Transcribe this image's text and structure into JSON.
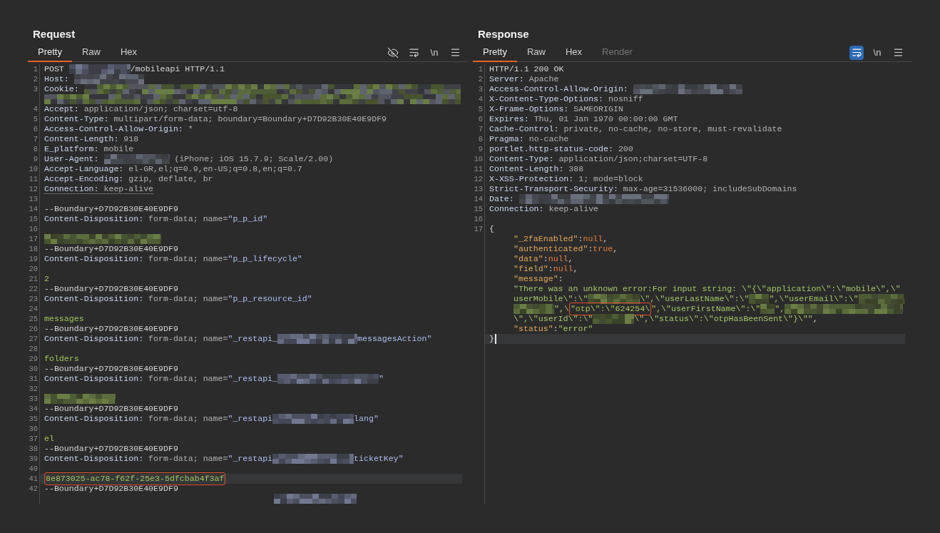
{
  "request": {
    "title": "Request",
    "focused": false,
    "tabs": [
      {
        "label": "Pretty",
        "selected": true,
        "disabled": false
      },
      {
        "label": "Raw",
        "selected": false,
        "disabled": false
      },
      {
        "label": "Hex",
        "selected": false,
        "disabled": false
      }
    ],
    "toolbar": [
      {
        "kind": "hide",
        "on": false
      },
      {
        "kind": "wrap",
        "on": false
      },
      {
        "kind": "newline",
        "label": "\\n",
        "on": false
      },
      {
        "kind": "menu",
        "on": false
      }
    ],
    "lines": [
      {
        "number": "1",
        "current": false,
        "segments": [
          {
            "kind": "plain",
            "text": "POST "
          },
          {
            "kind": "redacted"
          },
          {
            "kind": "plain",
            "text": "/mobileapi HTTP/1.1"
          }
        ]
      },
      {
        "number": "2",
        "current": false,
        "segments": [
          {
            "kind": "key",
            "text": "Host: "
          },
          {
            "kind": "redacted"
          }
        ]
      },
      {
        "number": "3",
        "current": false,
        "segments": [
          {
            "kind": "key",
            "text": "Cookie: "
          },
          {
            "kind": "redacted"
          }
        ]
      },
      {
        "current": false,
        "segments": [
          {
            "kind": "redacted"
          }
        ]
      },
      {
        "number": "4",
        "current": false,
        "segments": [
          {
            "kind": "key",
            "text": "Accept: "
          },
          {
            "kind": "value",
            "text": "application/json; charset=utf-8"
          }
        ]
      },
      {
        "number": "5",
        "current": false,
        "segments": [
          {
            "kind": "key",
            "text": "Content-Type: "
          },
          {
            "kind": "value",
            "text": "multipart/form-data; boundary=Boundary+D7D92B30E40E9DF9"
          }
        ]
      },
      {
        "number": "6",
        "current": false,
        "segments": [
          {
            "kind": "key",
            "text": "Access-Control-Allow-Origin: "
          },
          {
            "kind": "value",
            "text": "*"
          }
        ]
      },
      {
        "number": "7",
        "current": false,
        "segments": [
          {
            "kind": "key",
            "text": "Content-Length: "
          },
          {
            "kind": "value",
            "text": "918"
          }
        ]
      },
      {
        "number": "8",
        "current": false,
        "segments": [
          {
            "kind": "key",
            "text": "E_platform: "
          },
          {
            "kind": "value",
            "text": "mobile"
          }
        ]
      },
      {
        "number": "9",
        "current": false,
        "segments": [
          {
            "kind": "key",
            "text": "User-Agent: "
          },
          {
            "kind": "redacted"
          },
          {
            "kind": "value",
            "text": " (iPhone; iOS 15.7.9; Scale/2.00)"
          }
        ]
      },
      {
        "number": "10",
        "current": false,
        "segments": [
          {
            "kind": "key",
            "text": "Accept-Language: "
          },
          {
            "kind": "value",
            "text": "el-GR,el;q=0.9,en-US;q=0.8,en;q=0.7"
          }
        ]
      },
      {
        "number": "11",
        "current": false,
        "segments": [
          {
            "kind": "key",
            "text": "Accept-Encoding: "
          },
          {
            "kind": "value",
            "text": "gzip, deflate, br"
          }
        ]
      },
      {
        "number": "12",
        "current": false,
        "underlined": true,
        "segments": [
          {
            "kind": "key",
            "text": "Connection: "
          },
          {
            "kind": "value",
            "text": "keep-alive"
          }
        ]
      },
      {
        "number": "13",
        "current": false
      },
      {
        "number": "14",
        "current": false,
        "segments": [
          {
            "kind": "plain",
            "text": "--Boundary+D7D92B30E40E9DF9"
          }
        ]
      },
      {
        "number": "15",
        "current": false,
        "segments": [
          {
            "kind": "key",
            "text": "Content-Disposition: "
          },
          {
            "kind": "value",
            "text": "form-data; name="
          },
          {
            "kind": "name",
            "text": "\"p_p_id\""
          }
        ]
      },
      {
        "number": "16",
        "current": false
      },
      {
        "number": "17",
        "current": false,
        "segments": [
          {
            "kind": "redacted"
          }
        ]
      },
      {
        "number": "18",
        "current": false,
        "segments": [
          {
            "kind": "plain",
            "text": "--Boundary+D7D92B30E40E9DF9"
          }
        ]
      },
      {
        "number": "19",
        "current": false,
        "segments": [
          {
            "kind": "key",
            "text": "Content-Disposition: "
          },
          {
            "kind": "value",
            "text": "form-data; name="
          },
          {
            "kind": "name",
            "text": "\"p_p_lifecycle\""
          }
        ]
      },
      {
        "number": "20",
        "current": false
      },
      {
        "number": "21",
        "current": false,
        "segments": [
          {
            "kind": "data",
            "text": "2"
          }
        ]
      },
      {
        "number": "22",
        "current": false,
        "segments": [
          {
            "kind": "plain",
            "text": "--Boundary+D7D92B30E40E9DF9"
          }
        ]
      },
      {
        "number": "23",
        "current": false,
        "segments": [
          {
            "kind": "key",
            "text": "Content-Disposition: "
          },
          {
            "kind": "value",
            "text": "form-data; name="
          },
          {
            "kind": "name",
            "text": "\"p_p_resource_id\""
          }
        ]
      },
      {
        "number": "24",
        "current": false
      },
      {
        "number": "25",
        "current": false,
        "segments": [
          {
            "kind": "data",
            "text": "messages"
          }
        ]
      },
      {
        "number": "26",
        "current": false,
        "segments": [
          {
            "kind": "plain",
            "text": "--Boundary+D7D92B30E40E9DF9"
          }
        ]
      },
      {
        "number": "27",
        "current": false,
        "segments": [
          {
            "kind": "key",
            "text": "Content-Disposition: "
          },
          {
            "kind": "value",
            "text": "form-data; name="
          },
          {
            "kind": "name",
            "text": "\"_restapi_"
          },
          {
            "kind": "redacted"
          },
          {
            "kind": "name",
            "text": "messagesAction\""
          }
        ]
      },
      {
        "number": "28",
        "current": false
      },
      {
        "number": "29",
        "current": false,
        "segments": [
          {
            "kind": "data",
            "text": "folders"
          }
        ]
      },
      {
        "number": "30",
        "current": false,
        "segments": [
          {
            "kind": "plain",
            "text": "--Boundary+D7D92B30E40E9DF9"
          }
        ]
      },
      {
        "number": "31",
        "current": false,
        "segments": [
          {
            "kind": "key",
            "text": "Content-Disposition: "
          },
          {
            "kind": "value",
            "text": "form-data; name="
          },
          {
            "kind": "name",
            "text": "\"_restapi_"
          },
          {
            "kind": "redacted"
          },
          {
            "kind": "name",
            "text": "\""
          }
        ]
      },
      {
        "number": "32",
        "current": false
      },
      {
        "number": "33",
        "current": false,
        "segments": [
          {
            "kind": "redacted"
          }
        ]
      },
      {
        "number": "34",
        "current": false,
        "segments": [
          {
            "kind": "plain",
            "text": "--Boundary+D7D92B30E40E9DF9"
          }
        ]
      },
      {
        "number": "35",
        "current": false,
        "segments": [
          {
            "kind": "key",
            "text": "Content-Disposition: "
          },
          {
            "kind": "value",
            "text": "form-data; name="
          },
          {
            "kind": "name",
            "text": "\"_restapi"
          },
          {
            "kind": "redacted"
          },
          {
            "kind": "name",
            "text": "lang\""
          }
        ]
      },
      {
        "number": "36",
        "current": false
      },
      {
        "number": "37",
        "current": false,
        "segments": [
          {
            "kind": "data",
            "text": "el"
          }
        ]
      },
      {
        "number": "38",
        "current": false,
        "segments": [
          {
            "kind": "plain",
            "text": "--Boundary+D7D92B30E40E9DF9"
          }
        ]
      },
      {
        "number": "39",
        "current": false,
        "segments": [
          {
            "kind": "key",
            "text": "Content-Disposition: "
          },
          {
            "kind": "value",
            "text": "form-data; name="
          },
          {
            "kind": "name",
            "text": "\"_restapi"
          },
          {
            "kind": "redacted"
          },
          {
            "kind": "name",
            "text": "ticketKey\""
          }
        ]
      },
      {
        "number": "40",
        "current": false
      },
      {
        "number": "41",
        "current": true,
        "segments": [
          {
            "kind": "boxed",
            "text": "8e873025-ac78-f62f-25e3-5dfcbab4f3af"
          }
        ]
      },
      {
        "number": "42",
        "current": false,
        "segments": [
          {
            "kind": "plain",
            "text": "--Boundary+D7D92B30E40E9DF9"
          }
        ]
      }
    ]
  },
  "response": {
    "title": "Response",
    "focused": true,
    "tabs": [
      {
        "label": "Pretty",
        "selected": true,
        "disabled": false
      },
      {
        "label": "Raw",
        "selected": false,
        "disabled": false
      },
      {
        "label": "Hex",
        "selected": false,
        "disabled": false
      },
      {
        "label": "Render",
        "selected": false,
        "disabled": true
      }
    ],
    "toolbar": [
      {
        "kind": "wrap",
        "on": true
      },
      {
        "kind": "newline",
        "label": "\\n",
        "on": false
      },
      {
        "kind": "menu",
        "on": false
      }
    ],
    "lines": [
      {
        "number": "1",
        "current": false,
        "segments": [
          {
            "kind": "plain",
            "text": "HTTP/1.1 200 OK"
          }
        ]
      },
      {
        "number": "2",
        "current": false,
        "segments": [
          {
            "kind": "key",
            "text": "Server: "
          },
          {
            "kind": "value",
            "text": "Apache"
          }
        ]
      },
      {
        "number": "3",
        "current": false,
        "segments": [
          {
            "kind": "key",
            "text": "Access-Control-Allow-Origin: "
          },
          {
            "kind": "redacted"
          }
        ]
      },
      {
        "number": "4",
        "current": false,
        "segments": [
          {
            "kind": "key",
            "text": "X-Content-Type-Options: "
          },
          {
            "kind": "value",
            "text": "nosniff"
          }
        ]
      },
      {
        "number": "5",
        "current": false,
        "segments": [
          {
            "kind": "key",
            "text": "X-Frame-Options: "
          },
          {
            "kind": "value",
            "text": "SAMEORIGIN"
          }
        ]
      },
      {
        "number": "6",
        "current": false,
        "segments": [
          {
            "kind": "key",
            "text": "Expires: "
          },
          {
            "kind": "value",
            "text": "Thu, 01 Jan 1970 00:00:00 GMT"
          }
        ]
      },
      {
        "number": "7",
        "current": false,
        "segments": [
          {
            "kind": "key",
            "text": "Cache-Control: "
          },
          {
            "kind": "value",
            "text": "private, no-cache, no-store, must-revalidate"
          }
        ]
      },
      {
        "number": "8",
        "current": false,
        "segments": [
          {
            "kind": "key",
            "text": "Pragma: "
          },
          {
            "kind": "value",
            "text": "no-cache"
          }
        ]
      },
      {
        "number": "9",
        "current": false,
        "segments": [
          {
            "kind": "key",
            "text": "portlet.http-status-code: "
          },
          {
            "kind": "value",
            "text": "200"
          }
        ]
      },
      {
        "number": "10",
        "current": false,
        "segments": [
          {
            "kind": "key",
            "text": "Content-Type: "
          },
          {
            "kind": "value",
            "text": "application/json;charset=UTF-8"
          }
        ]
      },
      {
        "number": "11",
        "current": false,
        "segments": [
          {
            "kind": "key",
            "text": "Content-Length: "
          },
          {
            "kind": "value",
            "text": "388"
          }
        ]
      },
      {
        "number": "12",
        "current": false,
        "segments": [
          {
            "kind": "key",
            "text": "X-XSS-Protection: "
          },
          {
            "kind": "value",
            "text": "1; mode=block"
          }
        ]
      },
      {
        "number": "13",
        "current": false,
        "segments": [
          {
            "kind": "key",
            "text": "Strict-Transport-Security: "
          },
          {
            "kind": "value",
            "text": "max-age=31536000; includeSubDomains"
          }
        ]
      },
      {
        "number": "14",
        "current": false,
        "segments": [
          {
            "kind": "key",
            "text": "Date: "
          },
          {
            "kind": "redacted"
          }
        ]
      },
      {
        "number": "15",
        "current": false,
        "segments": [
          {
            "kind": "key",
            "text": "Connection: "
          },
          {
            "kind": "value",
            "text": "keep-alive"
          }
        ]
      },
      {
        "number": "16",
        "current": false
      },
      {
        "number": "17",
        "current": false,
        "segments": [
          {
            "kind": "plain",
            "text": "{"
          }
        ],
        "children": [
          {
            "segments": [
              {
                "kind": "jkey",
                "text": "\"_2faEnabled\""
              },
              {
                "kind": "punct",
                "text": ":"
              },
              {
                "kind": "literal",
                "text": "null"
              },
              {
                "kind": "punct",
                "text": ","
              }
            ]
          },
          {
            "segments": [
              {
                "kind": "jkey",
                "text": "\"authenticated\""
              },
              {
                "kind": "punct",
                "text": ":"
              },
              {
                "kind": "literal",
                "text": "true"
              },
              {
                "kind": "punct",
                "text": ","
              }
            ]
          },
          {
            "segments": [
              {
                "kind": "jkey",
                "text": "\"data\""
              },
              {
                "kind": "punct",
                "text": ":"
              },
              {
                "kind": "literal",
                "text": "null"
              },
              {
                "kind": "punct",
                "text": ","
              }
            ]
          },
          {
            "segments": [
              {
                "kind": "jkey",
                "text": "\"field\""
              },
              {
                "kind": "punct",
                "text": ":"
              },
              {
                "kind": "literal",
                "text": "null"
              },
              {
                "kind": "punct",
                "text": ","
              }
            ]
          },
          {
            "segments": [
              {
                "kind": "jkey",
                "text": "\"message\""
              },
              {
                "kind": "punct",
                "text": ":"
              }
            ]
          },
          {
            "segments": [
              {
                "kind": "string",
                "text": "\"There was an unknown error:For input string: \\\"{\\\"application\\\":\\\"mobile\\\",\\\""
              }
            ]
          },
          {
            "segments": [
              {
                "kind": "string",
                "text": "userMobile\\\":\\\""
              },
              {
                "kind": "redacted"
              },
              {
                "kind": "string",
                "text": "\\\",\\\"userLastName\\\":\\\""
              },
              {
                "kind": "redacted"
              },
              {
                "kind": "string",
                "text": "\",\\\"userEmail\\\":\\\""
              },
              {
                "kind": "redacted"
              }
            ]
          },
          {
            "segments": [
              {
                "kind": "redacted"
              },
              {
                "kind": "string",
                "text": "\",\\"
              },
              {
                "kind": "boxed",
                "text": "\"otp\\\":\\\"624254\\"
              },
              {
                "kind": "string",
                "text": "\",\\\"userFirstName\\\":\\\""
              },
              {
                "kind": "redacted"
              },
              {
                "kind": "string",
                "text": "\","
              },
              {
                "kind": "redacted"
              }
            ]
          },
          {
            "segments": [
              {
                "kind": "string",
                "text": "\\\",\\\"userId\\\":\\\""
              },
              {
                "kind": "redacted"
              },
              {
                "kind": "string",
                "text": "\\\",\\\"status\\\":\\\"otpHasBeenSent\\\"}\\\"\""
              },
              {
                "kind": "punct",
                "text": ","
              }
            ]
          },
          {
            "segments": [
              {
                "kind": "jkey",
                "text": "\"status\""
              },
              {
                "kind": "punct",
                "text": ":"
              },
              {
                "kind": "string",
                "text": "\"error\""
              }
            ]
          }
        ]
      },
      {
        "current": true,
        "segments": [
          {
            "kind": "plain",
            "text": "}"
          }
        ]
      }
    ]
  }
}
